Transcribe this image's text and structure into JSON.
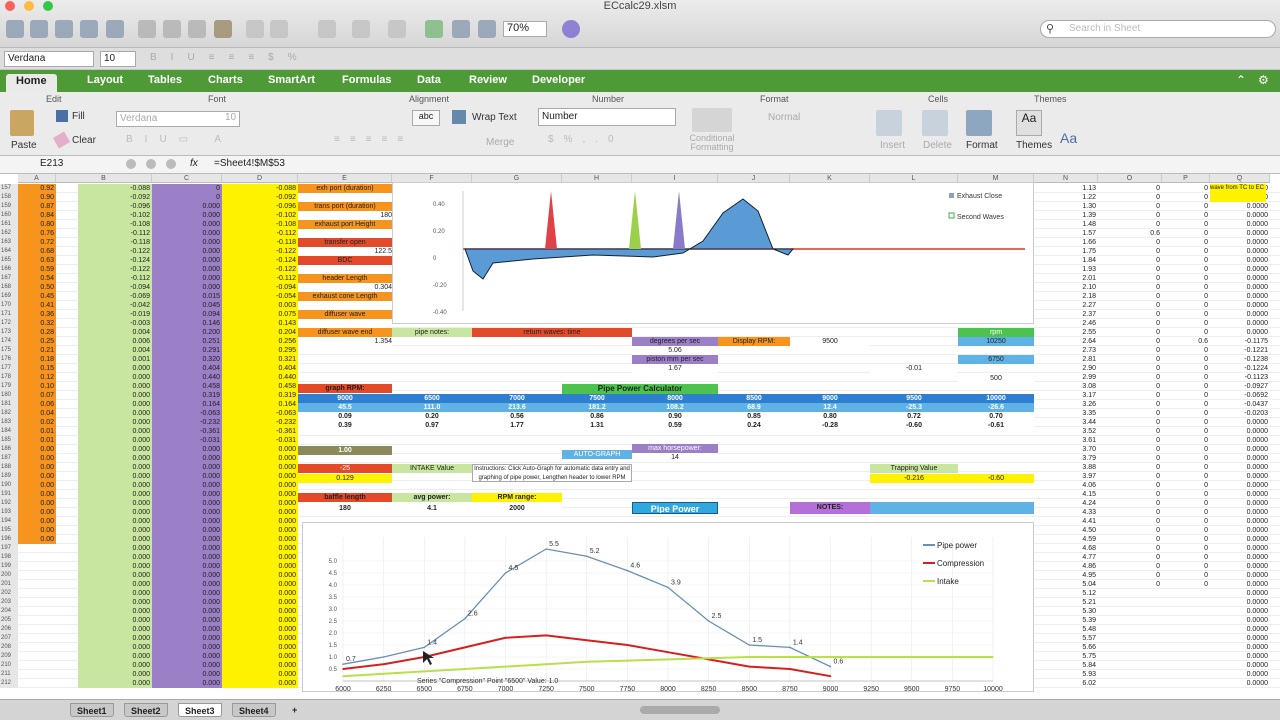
{
  "window": {
    "title": "ECcalc29.xlsm",
    "zoom": "70%",
    "search_placeholder": "Search in Sheet"
  },
  "font_bar": {
    "font": "Verdana",
    "size": "10"
  },
  "ribbon_tabs": [
    "Home",
    "Layout",
    "Tables",
    "Charts",
    "SmartArt",
    "Formulas",
    "Data",
    "Review",
    "Developer"
  ],
  "ribbon": {
    "groups": [
      "Edit",
      "Font",
      "Alignment",
      "Number",
      "Format",
      "Cells",
      "Themes"
    ],
    "fill": "Fill",
    "clear": "Clear",
    "paste": "Paste",
    "font": "Verdana",
    "size": "10",
    "wrap_text": "Wrap Text",
    "merge": "Merge",
    "number_format": "Number",
    "conditional": "Conditional Formatting",
    "style": "Normal",
    "insert": "Insert",
    "delete": "Delete",
    "format": "Format",
    "themes": "Themes"
  },
  "formula_bar": {
    "cell_ref": "E213",
    "fx": "fx",
    "formula": "=Sheet4!$M$53"
  },
  "columns": [
    "A",
    "B",
    "C",
    "D",
    "E",
    "F",
    "G",
    "H",
    "I",
    "J",
    "K",
    "L",
    "M",
    "N",
    "O",
    "P",
    "Q"
  ],
  "rows": [
    {
      "n": "157",
      "a": "0.92",
      "b": "-0.088",
      "c": "0",
      "d": "-0.088",
      "n2": "1.13",
      "o": "0",
      "p": "0",
      "q": "0.0000"
    },
    {
      "n": "158",
      "a": "0.90",
      "b": "-0.092",
      "c": "0",
      "d": "-0.092",
      "n2": "1.22",
      "o": "0",
      "p": "0",
      "q": "0.0000"
    },
    {
      "n": "159",
      "a": "0.87",
      "b": "-0.096",
      "c": "0.000",
      "d": "-0.096",
      "n2": "1.30",
      "o": "0",
      "p": "0",
      "q": "0.0000"
    },
    {
      "n": "160",
      "a": "0.84",
      "b": "-0.102",
      "c": "0.000",
      "d": "-0.102",
      "n2": "1.39",
      "o": "0",
      "p": "0",
      "q": "0.0000"
    },
    {
      "n": "161",
      "a": "0.80",
      "b": "-0.108",
      "c": "0.000",
      "d": "-0.108",
      "n2": "1.48",
      "o": "0",
      "p": "0",
      "q": "0.0000"
    },
    {
      "n": "162",
      "a": "0.76",
      "b": "-0.112",
      "c": "0.000",
      "d": "-0.112",
      "n2": "1.57",
      "o": "0.6",
      "p": "0",
      "q": "0.0000"
    },
    {
      "n": "163",
      "a": "0.72",
      "b": "-0.118",
      "c": "0.000",
      "d": "-0.118",
      "n2": "1.66",
      "o": "0",
      "p": "0",
      "q": "0.0000"
    },
    {
      "n": "164",
      "a": "0.68",
      "b": "-0.122",
      "c": "0.000",
      "d": "-0.122",
      "n2": "1.75",
      "o": "0",
      "p": "0",
      "q": "0.0000"
    },
    {
      "n": "165",
      "a": "0.63",
      "b": "-0.124",
      "c": "0.000",
      "d": "-0.124",
      "n2": "1.84",
      "o": "0",
      "p": "0",
      "q": "0.0000"
    },
    {
      "n": "166",
      "a": "0.59",
      "b": "-0.122",
      "c": "0.000",
      "d": "-0.122",
      "n2": "1.93",
      "o": "0",
      "p": "0",
      "q": "0.0000"
    },
    {
      "n": "167",
      "a": "0.54",
      "b": "-0.112",
      "c": "0.000",
      "d": "-0.112",
      "n2": "2.01",
      "o": "0",
      "p": "0",
      "q": "0.0000"
    },
    {
      "n": "168",
      "a": "0.50",
      "b": "-0.094",
      "c": "0.000",
      "d": "-0.094",
      "n2": "2.10",
      "o": "0",
      "p": "0",
      "q": "0.0000"
    },
    {
      "n": "169",
      "a": "0.45",
      "b": "-0.069",
      "c": "0.015",
      "d": "-0.054",
      "n2": "2.18",
      "o": "0",
      "p": "0",
      "q": "0.0000"
    },
    {
      "n": "170",
      "a": "0.41",
      "b": "-0.042",
      "c": "0.045",
      "d": "0.003",
      "n2": "2.27",
      "o": "0",
      "p": "0",
      "q": "0.0000"
    },
    {
      "n": "171",
      "a": "0.36",
      "b": "-0.019",
      "c": "0.094",
      "d": "0.075",
      "n2": "2.37",
      "o": "0",
      "p": "0",
      "q": "0.0000"
    },
    {
      "n": "172",
      "a": "0.32",
      "b": "-0.003",
      "c": "0.146",
      "d": "0.143",
      "n2": "2.46",
      "o": "0",
      "p": "0",
      "q": "0.0000"
    },
    {
      "n": "173",
      "a": "0.28",
      "b": "0.004",
      "c": "0.200",
      "d": "0.204",
      "n2": "2.55",
      "o": "0",
      "p": "0",
      "q": "0.0000"
    },
    {
      "n": "174",
      "a": "0.25",
      "b": "0.006",
      "c": "0.251",
      "d": "0.256",
      "n2": "2.64",
      "o": "0",
      "p": "0.6",
      "q": "-0.1175"
    },
    {
      "n": "175",
      "a": "0.21",
      "b": "0.004",
      "c": "0.291",
      "d": "0.295",
      "n2": "2.73",
      "o": "0",
      "p": "0",
      "q": "-0.1221"
    },
    {
      "n": "176",
      "a": "0.18",
      "b": "0.001",
      "c": "0.320",
      "d": "0.321",
      "n2": "2.81",
      "o": "0",
      "p": "0",
      "q": "-0.1238"
    },
    {
      "n": "177",
      "a": "0.15",
      "b": "0.000",
      "c": "0.404",
      "d": "0.404",
      "n2": "2.90",
      "o": "0",
      "p": "0",
      "q": "-0.1224"
    },
    {
      "n": "178",
      "a": "0.12",
      "b": "0.000",
      "c": "0.440",
      "d": "0.440",
      "n2": "2.99",
      "o": "0",
      "p": "0",
      "q": "-0.1123"
    },
    {
      "n": "179",
      "a": "0.10",
      "b": "0.000",
      "c": "0.458",
      "d": "0.458",
      "n2": "3.08",
      "o": "0",
      "p": "0",
      "q": "-0.0927"
    },
    {
      "n": "180",
      "a": "0.07",
      "b": "0.000",
      "c": "0.319",
      "d": "0.319",
      "n2": "3.17",
      "o": "0",
      "p": "0",
      "q": "-0.0692"
    },
    {
      "n": "181",
      "a": "0.06",
      "b": "0.000",
      "c": "0.164",
      "d": "0.164",
      "n2": "3.26",
      "o": "0",
      "p": "0",
      "q": "-0.0437"
    },
    {
      "n": "182",
      "a": "0.04",
      "b": "0.000",
      "c": "-0.063",
      "d": "-0.063",
      "n2": "3.35",
      "o": "0",
      "p": "0",
      "q": "-0.0203"
    },
    {
      "n": "183",
      "a": "0.02",
      "b": "0.000",
      "c": "-0.232",
      "d": "-0.232",
      "n2": "3.44",
      "o": "0",
      "p": "0",
      "q": "0.0000"
    },
    {
      "n": "184",
      "a": "0.01",
      "b": "0.000",
      "c": "-0.361",
      "d": "-0.361",
      "n2": "3.52",
      "o": "0",
      "p": "0",
      "q": "0.0000"
    },
    {
      "n": "185",
      "a": "0.01",
      "b": "0.000",
      "c": "-0.031",
      "d": "-0.031",
      "n2": "3.61",
      "o": "0",
      "p": "0",
      "q": "0.0000"
    },
    {
      "n": "186",
      "a": "0.00",
      "b": "0.000",
      "c": "0.000",
      "d": "0.000",
      "n2": "3.70",
      "o": "0",
      "p": "0",
      "q": "0.0000"
    },
    {
      "n": "187",
      "a": "0.00",
      "b": "0.000",
      "c": "0.000",
      "d": "0.000",
      "n2": "3.79",
      "o": "0",
      "p": "0",
      "q": "0.0000"
    },
    {
      "n": "188",
      "a": "0.00",
      "b": "0.000",
      "c": "0.000",
      "d": "0.000",
      "n2": "3.88",
      "o": "0",
      "p": "0",
      "q": "0.0000"
    },
    {
      "n": "189",
      "a": "0.00",
      "b": "0.000",
      "c": "0.000",
      "d": "0.000",
      "n2": "3.97",
      "o": "0",
      "p": "0",
      "q": "0.0000"
    },
    {
      "n": "190",
      "a": "0.00",
      "b": "0.000",
      "c": "0.000",
      "d": "0.000",
      "n2": "4.06",
      "o": "0",
      "p": "0",
      "q": "0.0000"
    },
    {
      "n": "191",
      "a": "0.00",
      "b": "0.000",
      "c": "0.000",
      "d": "0.000",
      "n2": "4.15",
      "o": "0",
      "p": "0",
      "q": "0.0000"
    },
    {
      "n": "192",
      "a": "0.00",
      "b": "0.000",
      "c": "0.000",
      "d": "0.000",
      "n2": "4.24",
      "o": "0",
      "p": "0",
      "q": "0.0000"
    },
    {
      "n": "193",
      "a": "0.00",
      "b": "0.000",
      "c": "0.000",
      "d": "0.000",
      "n2": "4.33",
      "o": "0",
      "p": "0",
      "q": "0.0000"
    },
    {
      "n": "194",
      "a": "0.00",
      "b": "0.000",
      "c": "0.000",
      "d": "0.000",
      "n2": "4.41",
      "o": "0",
      "p": "0",
      "q": "0.0000"
    },
    {
      "n": "195",
      "a": "0.00",
      "b": "0.000",
      "c": "0.000",
      "d": "0.000",
      "n2": "4.50",
      "o": "0",
      "p": "0",
      "q": "0.0000"
    },
    {
      "n": "196",
      "a": "0.00",
      "b": "0.000",
      "c": "0.000",
      "d": "0.000",
      "n2": "4.59",
      "o": "0",
      "p": "0",
      "q": "0.0000"
    },
    {
      "n": "197",
      "a": "",
      "b": "0.000",
      "c": "0.000",
      "d": "0.000",
      "n2": "4.68",
      "o": "0",
      "p": "0",
      "q": "0.0000"
    },
    {
      "n": "198",
      "a": "",
      "b": "0.000",
      "c": "0.000",
      "d": "0.000",
      "n2": "4.77",
      "o": "0",
      "p": "0",
      "q": "0.0000"
    },
    {
      "n": "199",
      "a": "",
      "b": "0.000",
      "c": "0.000",
      "d": "0.000",
      "n2": "4.86",
      "o": "0",
      "p": "0",
      "q": "0.0000"
    },
    {
      "n": "200",
      "a": "",
      "b": "0.000",
      "c": "0.000",
      "d": "0.000",
      "n2": "4.95",
      "o": "0",
      "p": "0",
      "q": "0.0000"
    },
    {
      "n": "201",
      "a": "",
      "b": "0.000",
      "c": "0.000",
      "d": "0.000",
      "n2": "5.04",
      "o": "0",
      "p": "0",
      "q": "0.0000"
    },
    {
      "n": "202",
      "a": "",
      "b": "0.000",
      "c": "0.000",
      "d": "0.000",
      "n2": "5.12",
      "o": "",
      "p": "",
      "q": "0.0000"
    },
    {
      "n": "203",
      "a": "",
      "b": "0.000",
      "c": "0.000",
      "d": "0.000",
      "n2": "5.21",
      "o": "",
      "p": "",
      "q": "0.0000"
    },
    {
      "n": "204",
      "a": "",
      "b": "0.000",
      "c": "0.000",
      "d": "0.000",
      "n2": "5.30",
      "o": "",
      "p": "",
      "q": "0.0000"
    },
    {
      "n": "205",
      "a": "",
      "b": "0.000",
      "c": "0.000",
      "d": "0.000",
      "n2": "5.39",
      "o": "",
      "p": "",
      "q": "0.0000"
    },
    {
      "n": "206",
      "a": "",
      "b": "0.000",
      "c": "0.000",
      "d": "0.000",
      "n2": "5.48",
      "o": "",
      "p": "",
      "q": "0.0000"
    },
    {
      "n": "207",
      "a": "",
      "b": "0.000",
      "c": "0.000",
      "d": "0.000",
      "n2": "5.57",
      "o": "",
      "p": "",
      "q": "0.0000"
    },
    {
      "n": "208",
      "a": "",
      "b": "0.000",
      "c": "0.000",
      "d": "0.000",
      "n2": "5.66",
      "o": "",
      "p": "",
      "q": "0.0000"
    },
    {
      "n": "209",
      "a": "",
      "b": "0.000",
      "c": "0.000",
      "d": "0.000",
      "n2": "5.75",
      "o": "",
      "p": "",
      "q": "0.0000"
    },
    {
      "n": "210",
      "a": "",
      "b": "0.000",
      "c": "0.000",
      "d": "0.000",
      "n2": "5.84",
      "o": "",
      "p": "",
      "q": "0.0000"
    },
    {
      "n": "211",
      "a": "",
      "b": "0.000",
      "c": "0.000",
      "d": "0.000",
      "n2": "5.93",
      "o": "",
      "p": "",
      "q": "0.0000"
    },
    {
      "n": "212",
      "a": "",
      "b": "0.000",
      "c": "0.000",
      "d": "0.000",
      "n2": "6.02",
      "o": "",
      "p": "",
      "q": "0.0000"
    }
  ],
  "calc_panel": {
    "port_labels": [
      "exh port (duration)",
      "trans port (duration)",
      "exhaust port Height",
      "transfer open",
      "BDC",
      "header Length",
      "exhaust cone Length",
      "diffuser wave",
      "diffuser wave end"
    ],
    "port_values": [
      "",
      "180",
      "",
      "122.5",
      "",
      "0.304",
      "",
      "",
      "1.354"
    ],
    "pipe_notes": "pipe notes:",
    "return_waves": "return waves: time",
    "degrees_per_sec": "degrees per sec",
    "degrees_value": "5.06",
    "piston_mm": "piston mm per sec",
    "piston_value": "1.67",
    "display_rpm": "Display RPM:",
    "display_rpm_value": "9500",
    "pipe_power_calc": "Pipe Power   Calculator",
    "rpm_row": [
      "9000",
      "6500",
      "7000",
      "7500",
      "8000",
      "8500",
      "9000",
      "9500",
      "10000"
    ],
    "power_row": [
      "45.5",
      "111.0",
      "213.6",
      "181.2",
      "108.2",
      "68.9",
      "12.4",
      "-25.3",
      "-26.6"
    ],
    "val_row1": [
      "0.09",
      "0.20",
      "0.56",
      "0.86",
      "0.90",
      "0.85",
      "0.80",
      "0.72",
      "0.70"
    ],
    "val_row2": [
      "0.39",
      "0.97",
      "1.77",
      "1.31",
      "0.59",
      "0.24",
      "-0.28",
      "-0.60",
      "-0.61"
    ],
    "graph_rpm": "graph RPM:",
    "intake_value": "INTAKE Value",
    "instructions": "Instructions: Click Auto-Graph for automatic data entry and graphing of pipe power, Lengthen header to lower RPM range of power. (or vice-versa)",
    "auto_graph": "AUTO-GRAPH",
    "max_hp": "max horsepower:",
    "max_hp_value": "14",
    "trapping_value": "Trapping Value",
    "trapping_num": "-0.216",
    "trapping_num2": "-0.60",
    "baffle_length": "baffle length",
    "baffle_value": "180",
    "avg_power": "avg power:",
    "avg_power_value": "4.1",
    "rpm_range": "RPM range:",
    "rpm_range_value": "2000",
    "pipe_power_btn": "Pipe Power",
    "notes": "NOTES:",
    "red_value": "-25",
    "one_value": "1.00",
    "yellow_small": "0.129",
    "m_label_rpm": "rpm",
    "m_value_10250": "10250",
    "m_value_6750": "6750",
    "m_value_500": "500",
    "l_value": "-0.01",
    "l_value_2": "-0.216",
    "q_note": "wave from TC to EC"
  },
  "top_chart": {
    "legend": [
      "Exhaust Close",
      "Second Waves"
    ],
    "y_ticks": [
      "0.40",
      "0.20",
      "0",
      "-0.20",
      "-0.40"
    ]
  },
  "chart_data": {
    "type": "line",
    "title": "",
    "categories": [
      "6000",
      "6250",
      "6500",
      "6750",
      "7000",
      "7250",
      "7500",
      "7750",
      "8000",
      "8250",
      "8500",
      "8750",
      "9000",
      "9250",
      "9500",
      "9750",
      "10000"
    ],
    "series": [
      {
        "name": "Pipe power",
        "color": "#6a8fb5",
        "values": [
          0.7,
          1.0,
          1.4,
          2.6,
          4.5,
          5.5,
          5.2,
          4.6,
          3.9,
          2.5,
          1.5,
          1.4,
          0.6,
          null,
          null,
          null,
          null
        ]
      },
      {
        "name": "Compression",
        "color": "#d81e1e",
        "values": [
          0.5,
          0.7,
          1.0,
          1.4,
          1.8,
          1.9,
          1.7,
          1.5,
          1.2,
          0.9,
          0.6,
          0.5,
          0.2,
          null,
          null,
          null,
          null
        ]
      },
      {
        "name": "Intake",
        "color": "#b8e04a",
        "values": [
          0.2,
          0.3,
          0.4,
          0.5,
          0.6,
          0.7,
          0.8,
          0.85,
          0.9,
          0.95,
          1.0,
          1.0,
          1.0,
          1.0,
          1.0,
          1.0,
          1.0
        ]
      }
    ],
    "point_labels": [
      "0.7",
      "1.4",
      "2.6",
      "4.5",
      "5.5",
      "5.2",
      "4.6",
      "3.9",
      "2.5",
      "1.5",
      "1.4",
      "0.6"
    ],
    "y_ticks": [
      "5.0",
      "4.5",
      "4.0",
      "3.5",
      "3.0",
      "2.5",
      "2.0",
      "1.5",
      "1.0",
      "0.5"
    ],
    "ylim": [
      0,
      6
    ],
    "tooltip": "Series \"Compression\" Point \"6500\" Value: 1.0"
  },
  "sheet_tabs": [
    "Sheet1",
    "Sheet2",
    "Sheet3",
    "Sheet4",
    "+"
  ],
  "colors": {
    "accent": "#4e9a36",
    "orange": "#f7941d",
    "yellow": "#fff200",
    "purple": "#9b7fc7",
    "green_cell": "#c8e6a0",
    "blue_cell": "#5fb2e6"
  }
}
